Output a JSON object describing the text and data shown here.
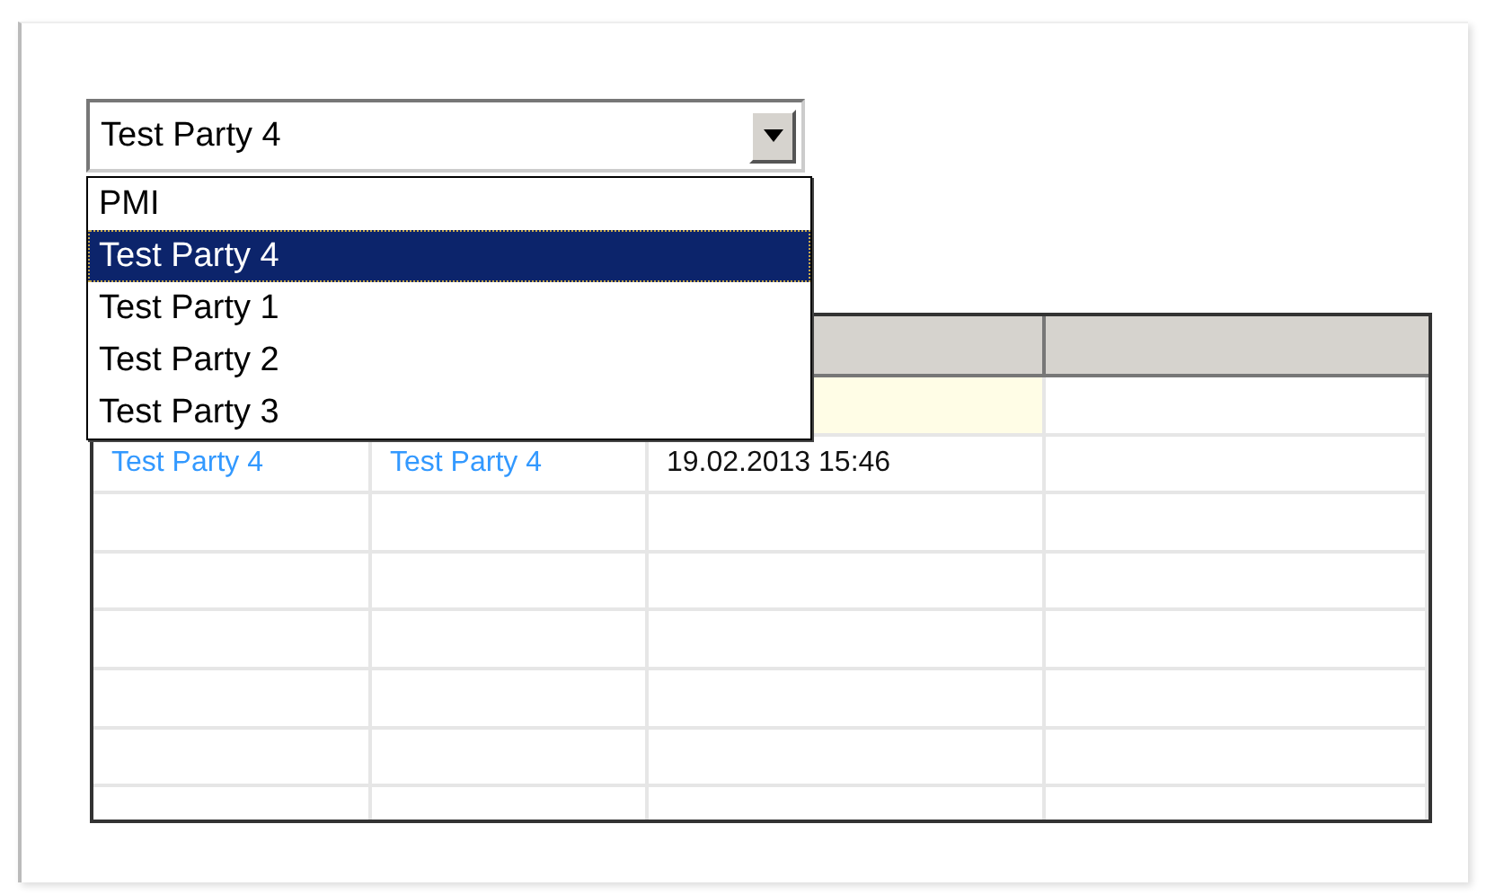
{
  "combo": {
    "value": "Test Party 4",
    "options": [
      {
        "label": "PMI",
        "selected": false
      },
      {
        "label": "Test Party 4",
        "selected": true
      },
      {
        "label": "Test Party 1",
        "selected": false
      },
      {
        "label": "Test Party 2",
        "selected": false
      },
      {
        "label": "Test Party 3",
        "selected": false
      }
    ]
  },
  "table": {
    "rows": [
      {
        "highlighted": true
      },
      {
        "highlighted": false,
        "cells": [
          {
            "text": "Test Party 4",
            "kind": "link"
          },
          {
            "text": "Test Party 4",
            "kind": "link"
          },
          {
            "text": "19.02.2013 15:46",
            "kind": "plain"
          }
        ]
      }
    ]
  }
}
